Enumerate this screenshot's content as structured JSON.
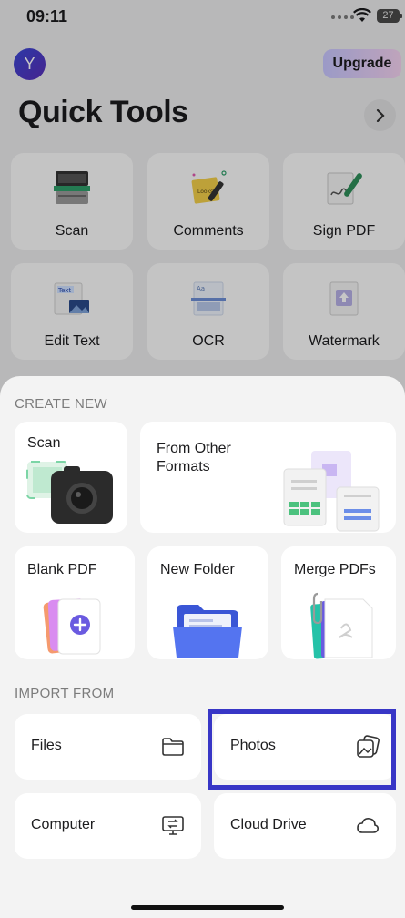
{
  "status_bar": {
    "time": "09:11",
    "battery": "27"
  },
  "header": {
    "avatar_initial": "Y",
    "upgrade_label": "Upgrade",
    "title": "Quick Tools"
  },
  "quick_tools": [
    {
      "label": "Scan",
      "icon": "scanner-icon"
    },
    {
      "label": "Comments",
      "icon": "sticky-note-icon"
    },
    {
      "label": "Sign PDF",
      "icon": "signature-pen-icon"
    },
    {
      "label": "Edit Text",
      "icon": "edit-text-icon"
    },
    {
      "label": "OCR",
      "icon": "ocr-icon"
    },
    {
      "label": "Watermark",
      "icon": "watermark-icon"
    }
  ],
  "create_new": {
    "heading": "CREATE NEW",
    "scan_label": "Scan",
    "other_formats_label": "From Other Formats",
    "blank_pdf_label": "Blank PDF",
    "new_folder_label": "New Folder",
    "merge_label": "Merge PDFs"
  },
  "import_from": {
    "heading": "IMPORT FROM",
    "items": [
      {
        "label": "Files",
        "icon": "folder-icon"
      },
      {
        "label": "Photos",
        "icon": "photos-icon"
      },
      {
        "label": "Computer",
        "icon": "computer-icon"
      },
      {
        "label": "Cloud Drive",
        "icon": "cloud-icon"
      }
    ]
  },
  "colors": {
    "accent": "#3836c6",
    "sheet": "#f3f3f3"
  }
}
